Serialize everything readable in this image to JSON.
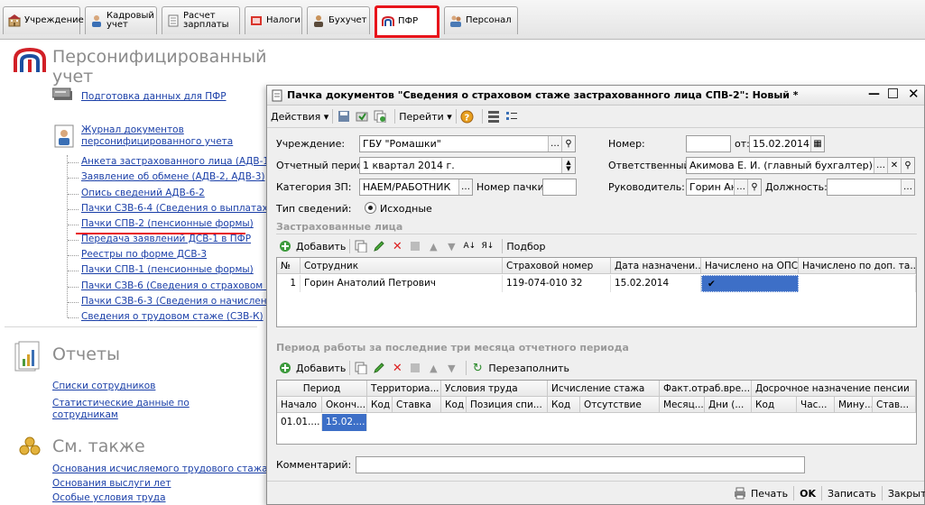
{
  "tabs": [
    {
      "label": "Учреждение",
      "icon": "building-icon"
    },
    {
      "label": "Кадровый учет",
      "icon": "person-icon"
    },
    {
      "label": "Расчет зарплаты",
      "icon": "document-icon"
    },
    {
      "label": "Налоги",
      "icon": "tax-icon"
    },
    {
      "label": "Бухучет",
      "icon": "accountant-icon"
    },
    {
      "label": "ПФР",
      "icon": "pfr-logo-icon"
    },
    {
      "label": "Персонал",
      "icon": "people-icon"
    }
  ],
  "left": {
    "title": "Персонифицированный учет",
    "prep_link": "Подготовка данных для ПФР",
    "journal_link_1": "Журнал документов",
    "journal_link_2": "персонифицированного учета",
    "tree_items": [
      "Анкета застрахованного лица (АДВ-1)",
      "Заявление об обмене (АДВ-2, АДВ-3)",
      "Опись сведений АДВ-6-2",
      "Пачки СЗВ-6-4 (Сведения о выплатах, ст",
      "Пачки СПВ-2 (пенсионные формы)",
      "Передача заявлений ДСВ-1 в ПФР",
      "Реестры по форме ДСВ-3",
      "Пачки СПВ-1 (пенсионные формы)",
      "Пачки СЗВ-6 (Сведения о страховом ста",
      "Пачки СЗВ-6-3 (Сведения о начисленном",
      "Сведения о трудовом стаже (СЗВ-К)"
    ],
    "reports_title": "Отчеты",
    "reports_links": [
      "Списки сотрудников",
      "Статистические данные по",
      "сотрудникам"
    ],
    "also_title": "См. также",
    "also_links": [
      "Основания исчисляемого трудового стажа",
      "Основания выслуги лет",
      "Особые условия труда"
    ]
  },
  "dialog": {
    "title": "Пачка документов \"Сведения о страховом стаже застрахованного лица СПВ-2\": Новый *",
    "toolbar": {
      "actions": "Действия",
      "goto": "Перейти"
    },
    "labels": {
      "org": "Учреждение:",
      "period": "Отчетный период:",
      "category": "Категория ЗП:",
      "pack_no": "Номер пачки:",
      "info_type": "Тип сведений:",
      "number": "Номер:",
      "date_from": "от:",
      "responsible": "Ответственный:",
      "head": "Руководитель:",
      "position": "Должность:"
    },
    "values": {
      "org": "ГБУ \"Ромашки\"",
      "period": "1 квартал 2014 г.",
      "category": "НАЕМ/РАБОТНИК",
      "pack_no": "",
      "info_type": "Исходные",
      "number": "",
      "date": "15.02.2014 0",
      "responsible": "Акимова Е. И. (главный бухгалтер)",
      "head": "Горин Ана",
      "position": ""
    },
    "insured": {
      "header": "Застрахованные лица",
      "add": "Добавить",
      "select": "Подбор",
      "columns": [
        "№",
        "Сотрудник",
        "Страховой номер",
        "Дата назначени...",
        "Начислено на ОПС",
        "Начислено по доп. та..."
      ],
      "rows": [
        {
          "n": "1",
          "employee": "Горин Анатолий Петрович",
          "snils": "119-074-010 32",
          "date": "15.02.2014",
          "ops": "✔",
          "extra": ""
        }
      ]
    },
    "work": {
      "header": "Период работы за последние три месяца отчетного периода",
      "add": "Добавить",
      "refill": "Перезаполнить",
      "groups": [
        "Период",
        "Территориа...",
        "Условия труда",
        "Исчисление стажа",
        "Факт.отраб.вре...",
        "Досрочное назначение пенсии"
      ],
      "columns": [
        "Начало",
        "Оконч...",
        "Код",
        "Ставка",
        "Код",
        "Позиция спи...",
        "Код",
        "Отсутствие",
        "Месяц...",
        "Дни (...",
        "Код",
        "Час...",
        "Мину...",
        "Став..."
      ],
      "row": {
        "start": "01.01....",
        "end": "15.02...."
      }
    },
    "comment_label": "Комментарий:",
    "comment": "",
    "footer": {
      "print": "Печать",
      "ok": "OK",
      "save": "Записать",
      "close": "Закрыть"
    }
  }
}
